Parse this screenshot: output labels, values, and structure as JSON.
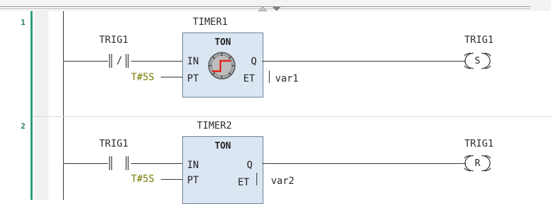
{
  "rungs": [
    {
      "number": "1",
      "instance": "TIMER1",
      "block_type": "TON",
      "contact": {
        "name": "TRIG1",
        "glyph": "/"
      },
      "pt_value": "T#5S",
      "pins": {
        "in": "IN",
        "pt": "PT",
        "q": "Q",
        "et": "ET"
      },
      "et_var": "var1",
      "coil": {
        "name": "TRIG1",
        "letter": "S"
      },
      "has_icon": true
    },
    {
      "number": "2",
      "instance": "TIMER2",
      "block_type": "TON",
      "contact": {
        "name": "TRIG1",
        "glyph": ""
      },
      "pt_value": "T#5S",
      "pins": {
        "in": "IN",
        "pt": "PT",
        "q": "Q",
        "et": "ET"
      },
      "et_var": "var2",
      "coil": {
        "name": "TRIG1",
        "letter": "R"
      },
      "has_icon": false
    }
  ],
  "colors": {
    "rail_bar": "#2c9c7c",
    "block_fill": "#dbe6f3",
    "constant": "#7a7a00"
  }
}
